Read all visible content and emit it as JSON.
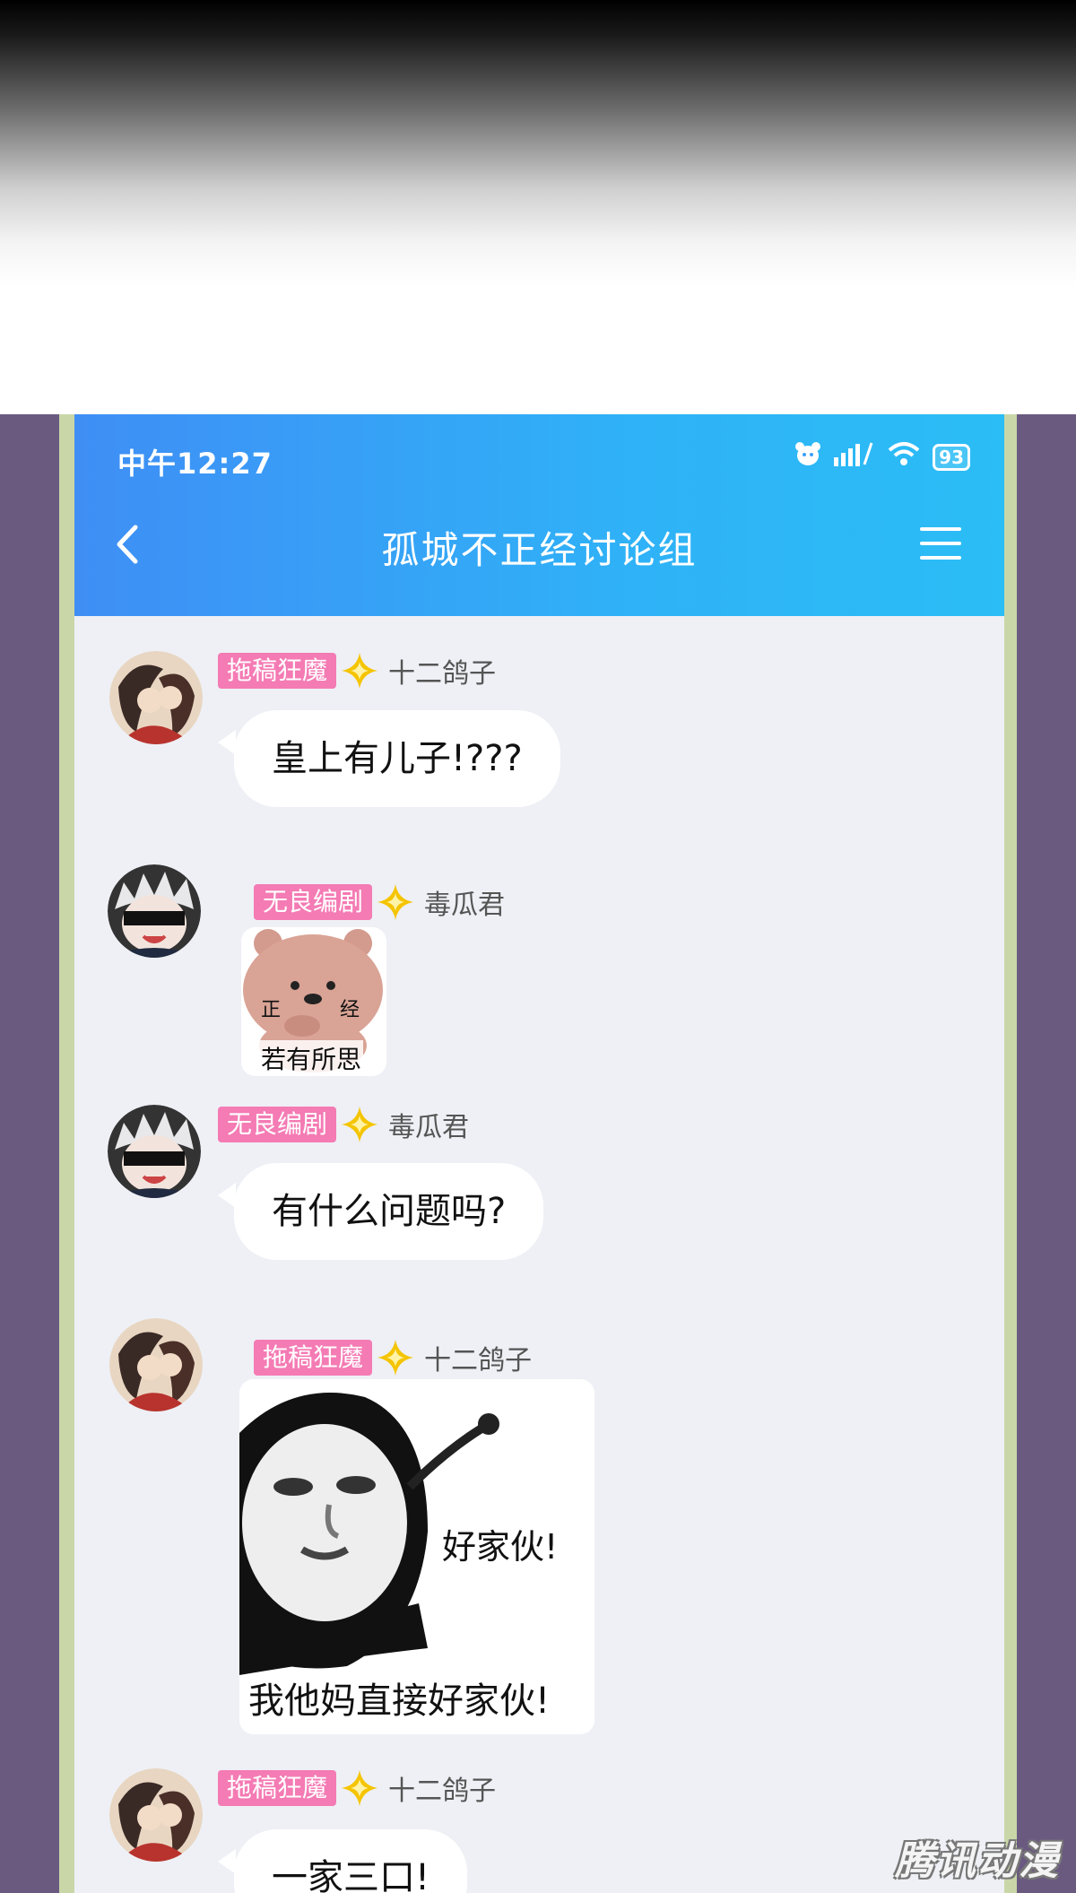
{
  "status_bar": {
    "time": "中午12:27",
    "battery": "93"
  },
  "header": {
    "title": "孤城不正经讨论组"
  },
  "messages": [
    {
      "tag": "拖稿狂魔",
      "user": "十二鸽子",
      "text": "皇上有儿子!???"
    },
    {
      "tag": "无良编剧",
      "user": "毒瓜君",
      "sticker_caption": "若有所思",
      "sticker_marks": [
        "正",
        "经"
      ]
    },
    {
      "tag": "无良编剧",
      "user": "毒瓜君",
      "text": "有什么问题吗?"
    },
    {
      "tag": "拖稿狂魔",
      "user": "十二鸽子",
      "sticker_caption": "我他妈直接好家伙!",
      "sticker_inner": "好家伙!"
    },
    {
      "tag": "拖稿狂魔",
      "user": "十二鸽子",
      "text": "一家三口!"
    }
  ],
  "watermark": "腾讯动漫",
  "colors": {
    "appbar_start": "#3f8ef5",
    "appbar_end": "#2bbdf5",
    "tag_pink": "#f47bb4",
    "star_gold": "#f5c400",
    "chat_bg": "#eef0f5",
    "frame_purple": "#6a5a80"
  }
}
